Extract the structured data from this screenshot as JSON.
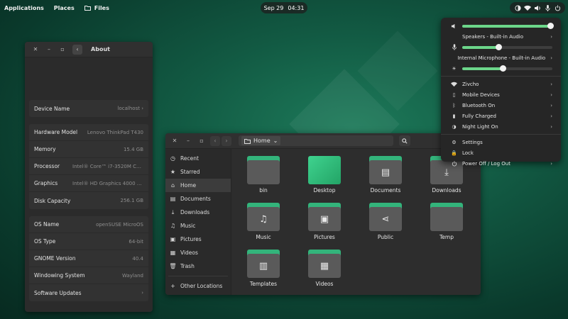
{
  "topbar": {
    "applications": "Applications",
    "places": "Places",
    "files": "Files",
    "date": "Sep 29",
    "time": "04:31",
    "tray_icons": [
      "night-light-icon",
      "wifi-icon",
      "volume-icon",
      "microphone-icon",
      "power-icon"
    ]
  },
  "about": {
    "title": "About",
    "group1": [
      {
        "label": "Device Name",
        "value": "localhost"
      }
    ],
    "group2": [
      {
        "label": "Hardware Model",
        "value": "Lenovo ThinkPad T430"
      },
      {
        "label": "Memory",
        "value": "15.4 GB"
      },
      {
        "label": "Processor",
        "value": "Intel® Core™ i7-3520M CPU @ 2...."
      },
      {
        "label": "Graphics",
        "value": "Intel® HD Graphics 4000 (IVB GT2)"
      },
      {
        "label": "Disk Capacity",
        "value": "256.1 GB"
      }
    ],
    "group3": [
      {
        "label": "OS Name",
        "value": "openSUSE MicroOS"
      },
      {
        "label": "OS Type",
        "value": "64-bit"
      },
      {
        "label": "GNOME Version",
        "value": "40.4"
      },
      {
        "label": "Windowing System",
        "value": "Wayland"
      },
      {
        "label": "Software Updates",
        "value": ""
      }
    ]
  },
  "files": {
    "path": "Home",
    "sidebar": [
      {
        "label": "Recent",
        "icon": "clock-icon"
      },
      {
        "label": "Starred",
        "icon": "star-icon"
      },
      {
        "label": "Home",
        "icon": "home-icon"
      },
      {
        "label": "Documents",
        "icon": "document-icon"
      },
      {
        "label": "Downloads",
        "icon": "download-icon"
      },
      {
        "label": "Music",
        "icon": "music-icon"
      },
      {
        "label": "Pictures",
        "icon": "picture-icon"
      },
      {
        "label": "Videos",
        "icon": "video-icon"
      },
      {
        "label": "Trash",
        "icon": "trash-icon"
      },
      {
        "label": "Other Locations",
        "icon": "plus-icon"
      }
    ],
    "folders": [
      {
        "label": "bin"
      },
      {
        "label": "Desktop"
      },
      {
        "label": "Documents"
      },
      {
        "label": "Downloads"
      },
      {
        "label": "Music"
      },
      {
        "label": "Pictures"
      },
      {
        "label": "Public"
      },
      {
        "label": "Temp"
      },
      {
        "label": "Templates"
      },
      {
        "label": "Videos"
      }
    ]
  },
  "quick_settings": {
    "volume_level": 0.98,
    "output_device": "Speakers - Built-in Audio",
    "mic_level": 0.4,
    "input_device": "Internal Microphone - Built-in Audio",
    "brightness_level": 0.45,
    "wifi": "Zivcho",
    "mobile": "Mobile Devices",
    "bluetooth": "Bluetooth On",
    "battery": "Fully Charged",
    "night_light": "Night Light On",
    "settings": "Settings",
    "lock": "Lock",
    "power": "Power Off / Log Out"
  }
}
